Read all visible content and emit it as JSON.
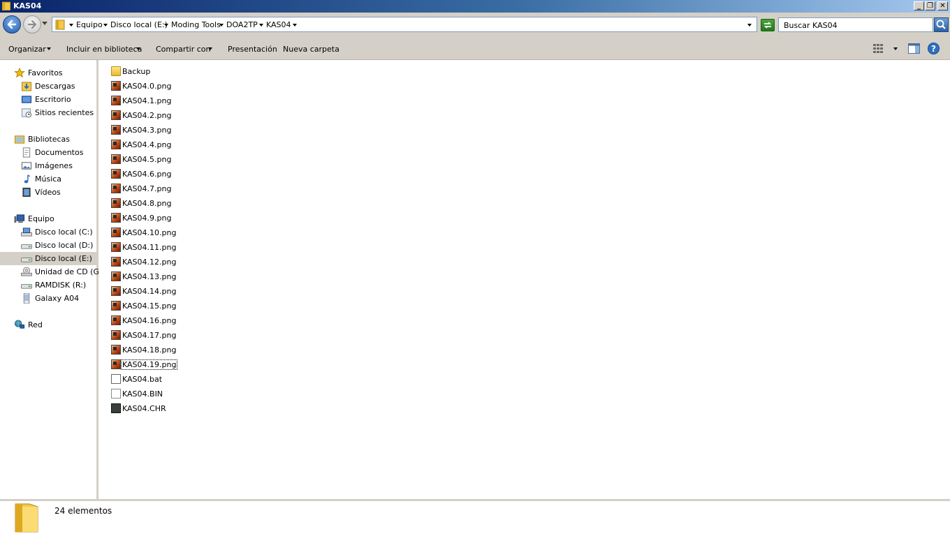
{
  "window": {
    "title": "KAS04"
  },
  "address": {
    "crumbs": [
      "Equipo",
      "Disco local (E:)",
      "Moding Tools",
      "DOA2TP",
      "KAS04"
    ],
    "search_placeholder": "Buscar KAS04"
  },
  "toolbar": {
    "organize": "Organizar",
    "include_library": "Incluir en biblioteca",
    "share": "Compartir con",
    "presentation": "Presentación",
    "new_folder": "Nueva carpeta"
  },
  "sidebar": {
    "favorites": {
      "label": "Favoritos",
      "items": [
        "Descargas",
        "Escritorio",
        "Sitios recientes"
      ]
    },
    "libraries": {
      "label": "Bibliotecas",
      "items": [
        "Documentos",
        "Imágenes",
        "Música",
        "Vídeos"
      ]
    },
    "computer": {
      "label": "Equipo",
      "items": [
        "Disco local (C:)",
        "Disco local (D:)",
        "Disco local (E:)",
        "Unidad de CD (G:)",
        "RAMDISK (R:)",
        "Galaxy A04"
      ],
      "selected": "Disco local (E:)"
    },
    "network": {
      "label": "Red"
    }
  },
  "files": [
    {
      "name": "Backup",
      "type": "folder"
    },
    {
      "name": "KAS04.0.png",
      "type": "png"
    },
    {
      "name": "KAS04.1.png",
      "type": "png"
    },
    {
      "name": "KAS04.2.png",
      "type": "png"
    },
    {
      "name": "KAS04.3.png",
      "type": "png"
    },
    {
      "name": "KAS04.4.png",
      "type": "png"
    },
    {
      "name": "KAS04.5.png",
      "type": "png"
    },
    {
      "name": "KAS04.6.png",
      "type": "png"
    },
    {
      "name": "KAS04.7.png",
      "type": "png"
    },
    {
      "name": "KAS04.8.png",
      "type": "png"
    },
    {
      "name": "KAS04.9.png",
      "type": "png"
    },
    {
      "name": "KAS04.10.png",
      "type": "png"
    },
    {
      "name": "KAS04.11.png",
      "type": "png"
    },
    {
      "name": "KAS04.12.png",
      "type": "png"
    },
    {
      "name": "KAS04.13.png",
      "type": "png"
    },
    {
      "name": "KAS04.14.png",
      "type": "png"
    },
    {
      "name": "KAS04.15.png",
      "type": "png"
    },
    {
      "name": "KAS04.16.png",
      "type": "png"
    },
    {
      "name": "KAS04.17.png",
      "type": "png"
    },
    {
      "name": "KAS04.18.png",
      "type": "png"
    },
    {
      "name": "KAS04.19.png",
      "type": "png",
      "focused": true
    },
    {
      "name": "KAS04.bat",
      "type": "bat"
    },
    {
      "name": "KAS04.BIN",
      "type": "bin"
    },
    {
      "name": "KAS04.CHR",
      "type": "chr"
    }
  ],
  "status": {
    "count": "24 elementos"
  },
  "icons": {
    "back": "back-arrow-icon",
    "forward": "forward-arrow-icon",
    "refresh": "refresh-icon",
    "search": "search-icon",
    "views": "views-icon",
    "preview": "preview-pane-icon",
    "help": "help-icon"
  }
}
